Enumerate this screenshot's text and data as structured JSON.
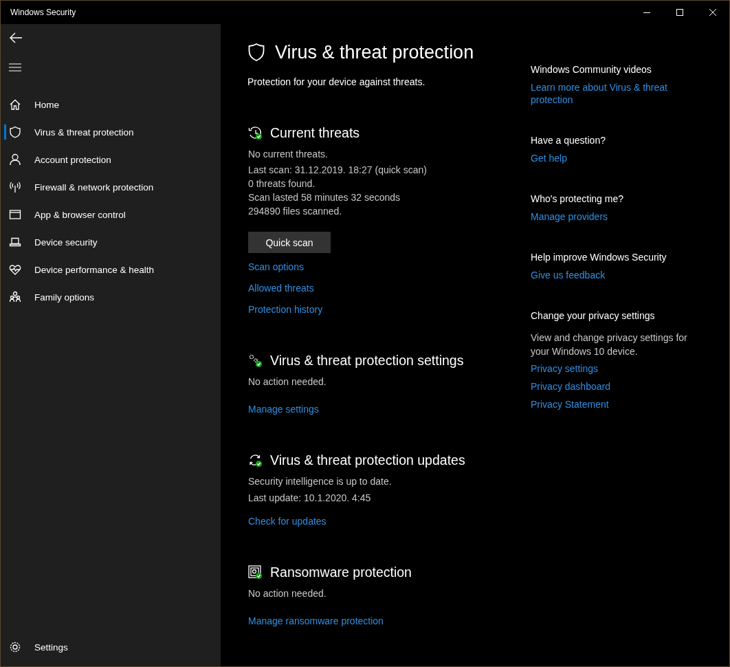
{
  "window": {
    "title": "Windows Security"
  },
  "sidebar": {
    "items": [
      {
        "kind": "home",
        "label": "Home",
        "selected": false
      },
      {
        "kind": "shield",
        "label": "Virus & threat protection",
        "selected": true
      },
      {
        "kind": "person",
        "label": "Account protection",
        "selected": false
      },
      {
        "kind": "antenna",
        "label": "Firewall & network protection",
        "selected": false
      },
      {
        "kind": "browser",
        "label": "App & browser control",
        "selected": false
      },
      {
        "kind": "laptop",
        "label": "Device security",
        "selected": false
      },
      {
        "kind": "heart",
        "label": "Device performance & health",
        "selected": false
      },
      {
        "kind": "family",
        "label": "Family options",
        "selected": false
      }
    ],
    "settings": {
      "label": "Settings"
    }
  },
  "page": {
    "title": "Virus & threat protection",
    "subtitle": "Protection for your device against threats."
  },
  "sections": [
    {
      "kind": "history",
      "title": "Current threats",
      "status": "No current threats.",
      "details": [
        "Last scan: 31.12.2019. 18:27 (quick scan)",
        "0 threats found.",
        "Scan lasted 58 minutes 32 seconds",
        "294890 files scanned."
      ],
      "button": "Quick scan",
      "links": [
        "Scan options",
        "Allowed threats",
        "Protection history"
      ]
    },
    {
      "kind": "gears",
      "title": "Virus & threat protection settings",
      "status": "No action needed.",
      "links": [
        "Manage settings"
      ]
    },
    {
      "kind": "sync",
      "title": "Virus & threat protection updates",
      "status": "Security intelligence is up to date.",
      "details": [
        "Last update: 10.1.2020. 4:45"
      ],
      "links": [
        "Check for updates"
      ]
    },
    {
      "kind": "ransomware",
      "title": "Ransomware protection",
      "status": "No action needed.",
      "links": [
        "Manage ransomware protection"
      ]
    }
  ],
  "aside": [
    {
      "title": "Windows Community videos",
      "links": [
        "Learn more about Virus & threat protection"
      ]
    },
    {
      "title": "Have a question?",
      "links": [
        "Get help"
      ]
    },
    {
      "title": "Who's protecting me?",
      "links": [
        "Manage providers"
      ]
    },
    {
      "title": "Help improve Windows Security",
      "links": [
        "Give us feedback"
      ]
    },
    {
      "title": "Change your privacy settings",
      "text": "View and change privacy settings for your Windows 10 device.",
      "links": [
        "Privacy settings",
        "Privacy dashboard",
        "Privacy Statement"
      ]
    }
  ]
}
